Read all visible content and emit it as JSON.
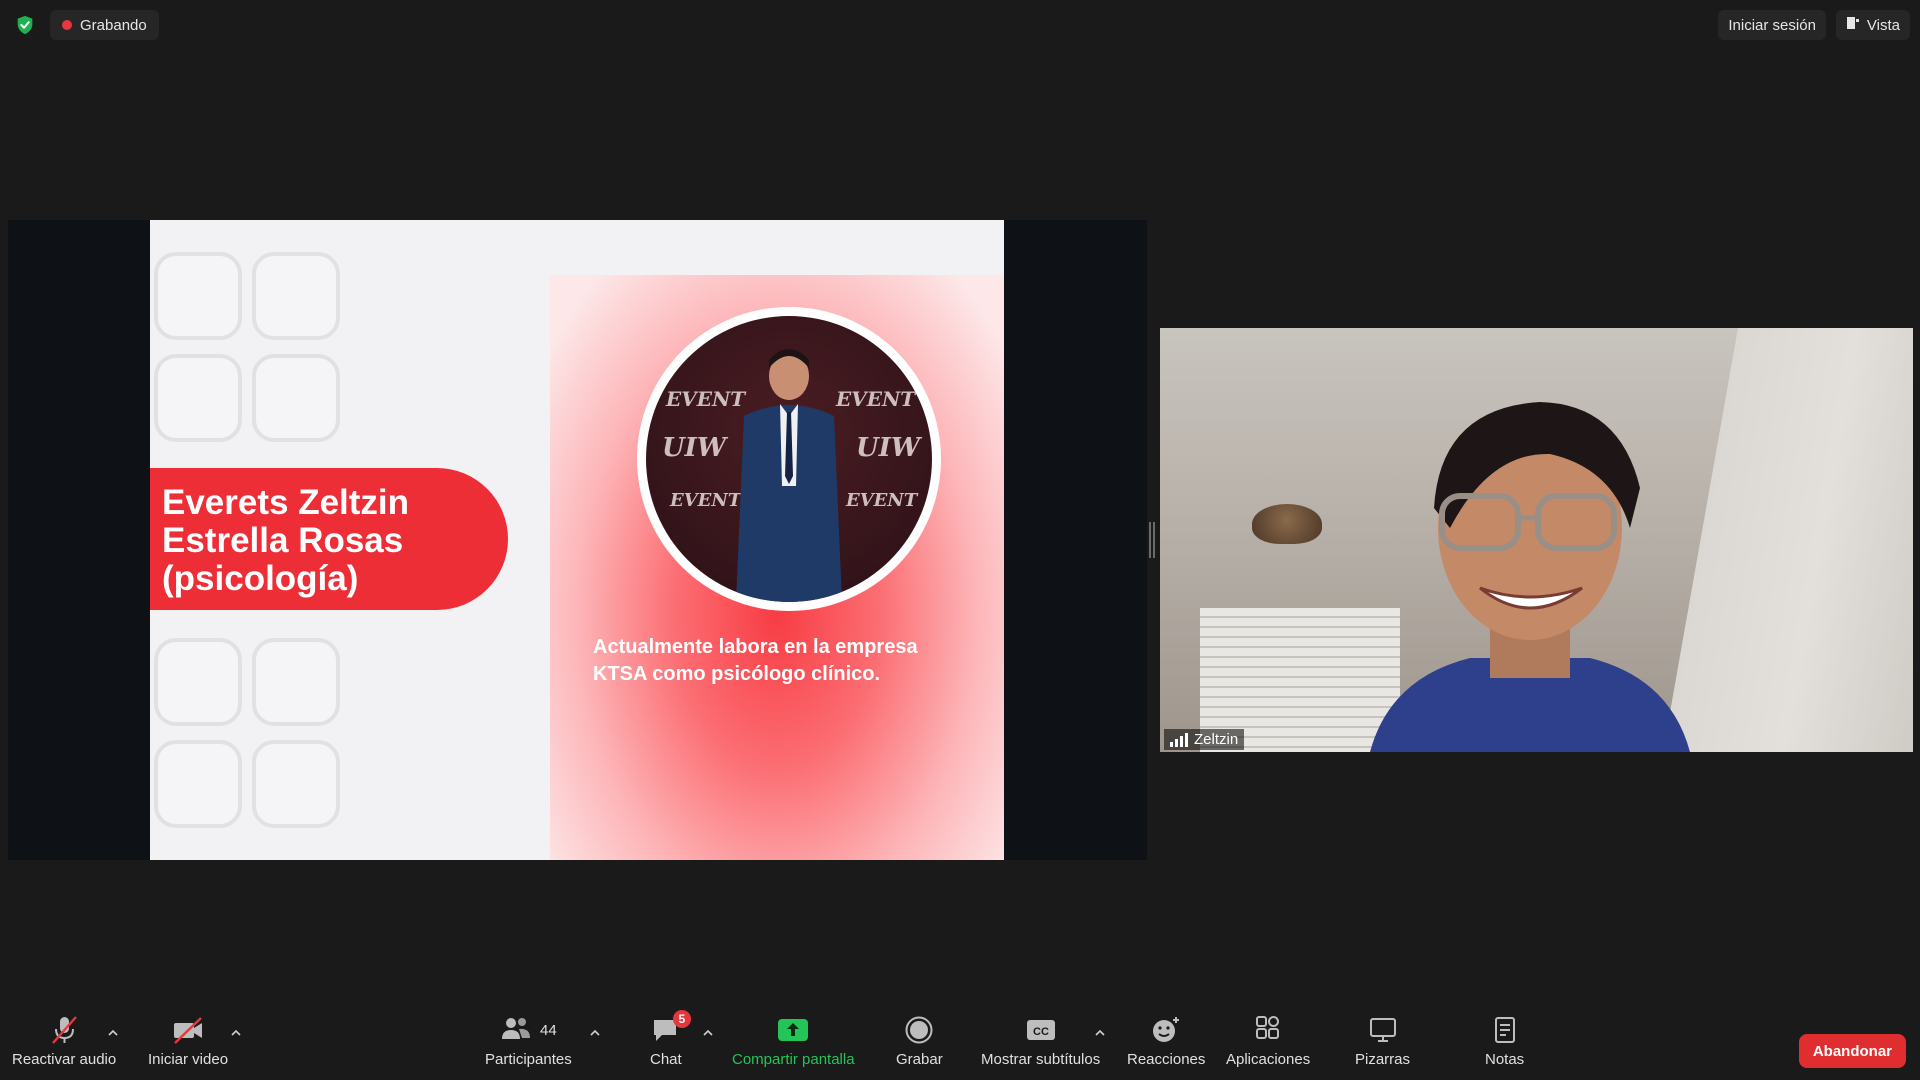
{
  "topbar": {
    "recording_label": "Grabando",
    "sign_in_label": "Iniciar sesión",
    "view_label": "Vista"
  },
  "slide": {
    "name_lines": [
      "Everets Zeltzin",
      "Estrella Rosas",
      "(psicología)"
    ],
    "description": "Actualmente labora en la empresa KTSA como psicólogo clínico."
  },
  "video": {
    "participant_name": "Zeltzin"
  },
  "toolbar": {
    "unmute_label": "Reactivar audio",
    "start_video_label": "Iniciar video",
    "participants_label": "Participantes",
    "participants_count": "44",
    "chat_label": "Chat",
    "chat_badge": "5",
    "share_label": "Compartir pantalla",
    "record_label": "Grabar",
    "captions_label": "Mostrar subtítulos",
    "captions_icon_text": "CC",
    "reactions_label": "Reacciones",
    "apps_label": "Aplicaciones",
    "whiteboards_label": "Pizarras",
    "notes_label": "Notas",
    "leave_label": "Abandonar"
  },
  "colors": {
    "share_green": "#24c456",
    "leave_red": "#e02e30",
    "slide_red": "#ee2e36",
    "recording_dot": "#e8383d"
  },
  "icons": [
    "shield-check-icon",
    "microphone-muted-icon",
    "camera-off-icon",
    "participants-icon",
    "chat-icon",
    "share-screen-icon",
    "record-icon",
    "captions-icon",
    "reactions-icon",
    "apps-icon",
    "whiteboard-icon",
    "notes-icon",
    "signal-icon",
    "view-icon"
  ]
}
